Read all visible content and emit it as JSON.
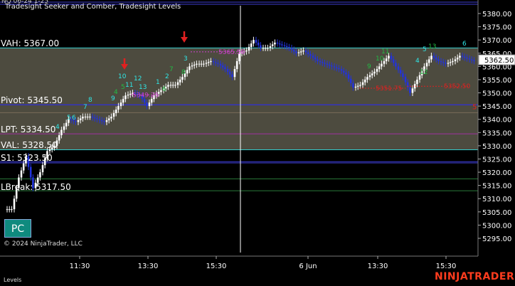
{
  "indicator_label": "Tradesight Seeker and Comber, Tradesight Levels",
  "top_cut_text": "NQ 06-24 1-25",
  "copyright": "© 2024 NinjaTrader, LLC",
  "bottom_tab": "Levels",
  "brand": {
    "part1": "NINJA",
    "part2": "TRADER"
  },
  "pc_button": "PC",
  "price_axis": {
    "ticks": [
      "5380.00",
      "5375.00",
      "5370.00",
      "5365.00",
      "5360.00",
      "5355.00",
      "5350.00",
      "5345.00",
      "5340.00",
      "5335.00",
      "5330.00",
      "5325.00",
      "5320.00",
      "5315.00",
      "5310.00",
      "5305.00",
      "5300.00",
      "5295.00"
    ],
    "last_price": "5362.50"
  },
  "time_axis": {
    "ticks": [
      "11:30",
      "13:30",
      "15:30",
      "6 Jun",
      "13:30",
      "15:30"
    ]
  },
  "level_labels": {
    "vah": "VAH: 5367.00",
    "pivot": "Pivot: 5345.50",
    "lpt": "LPT: 5334.50",
    "val": "VAL: 5328.50",
    "s1": "S1: 5323.50",
    "overlap": "LBreak: 5317.50"
  },
  "annotations": {
    "magenta_1": "5349.25",
    "magenta_2": "5365.50",
    "red_1": "5351.75",
    "red_2": "5352.50",
    "pivot_marker": "5"
  },
  "seeker_numbers": [
    "4",
    "5",
    "6",
    "7",
    "8",
    "9",
    "10",
    "11",
    "12",
    "13",
    "1",
    "2",
    "3",
    "4",
    "5",
    "6"
  ],
  "colors": {
    "background": "#000000",
    "value_area": "#4d4b3f",
    "up_bar": "#ffffff",
    "down_bar": "#2233dd",
    "vah_line": "#3cc",
    "pivot_line": "#2a2aff",
    "red_marker": "#e02020",
    "cyan_number": "#2fe6e6",
    "green_number": "#22bb44",
    "magenta": "#d040d0",
    "brand_red": "#ff3c1e"
  }
}
